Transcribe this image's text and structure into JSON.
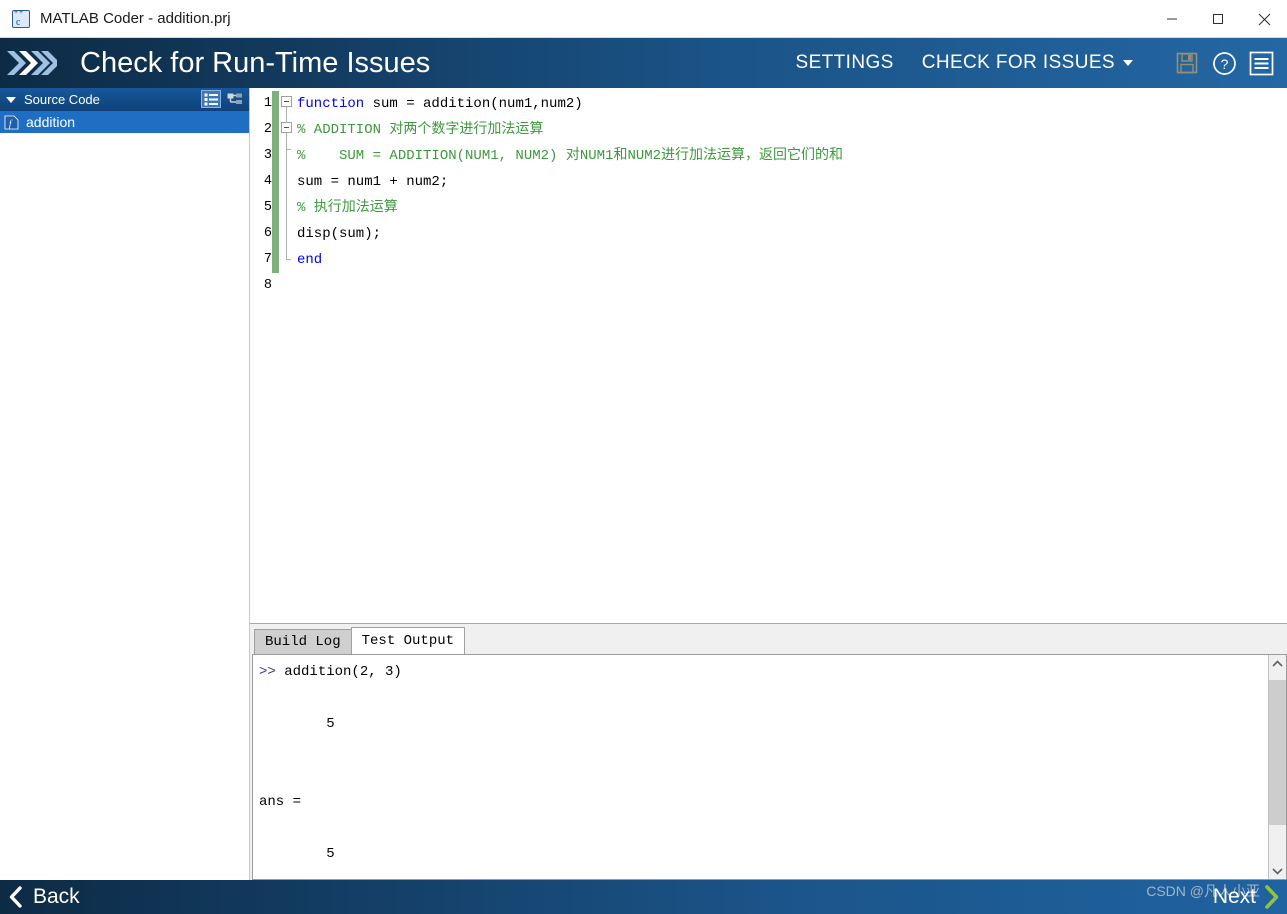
{
  "window": {
    "title": "MATLAB Coder - addition.prj",
    "icon": "matlab-coder-icon",
    "controls": [
      {
        "name": "minimize",
        "glyph": "minimize-icon"
      },
      {
        "name": "maximize",
        "glyph": "maximize-icon"
      },
      {
        "name": "close",
        "glyph": "close-icon"
      }
    ]
  },
  "toolbar": {
    "logo": "chevrons-icon",
    "title": "Check for Run-Time Issues",
    "settings_label": "SETTINGS",
    "check_label": "CHECK FOR ISSUES",
    "check_has_caret": true,
    "icons": [
      {
        "name": "save-icon",
        "enabled": false
      },
      {
        "name": "help-icon",
        "enabled": true
      },
      {
        "name": "menu-icon",
        "enabled": true
      }
    ],
    "colors": {
      "gradient_start": "#0d2b45",
      "gradient_end": "#2467a3",
      "text": "#ffffff"
    }
  },
  "sidebar": {
    "header": {
      "label": "Source Code",
      "collapsed": false
    },
    "header_icons": [
      {
        "name": "list-view-icon",
        "selected": true
      },
      {
        "name": "tree-view-icon",
        "selected": false
      }
    ],
    "items": [
      {
        "label": "addition",
        "icon": "matlab-function-file-icon",
        "selected": true
      }
    ]
  },
  "editor": {
    "line_numbers": [
      "1",
      "2",
      "3",
      "4",
      "5",
      "6",
      "7",
      "8"
    ],
    "modified_marker_color": "#7db07b",
    "lines": [
      [
        {
          "t": "function",
          "c": "kw"
        },
        {
          "t": " sum = addition(num1,num2)",
          "c": "df"
        }
      ],
      [
        {
          "t": "% ADDITION 对两个数字进行加法运算",
          "c": "cm"
        }
      ],
      [
        {
          "t": "%    SUM = ADDITION(NUM1, NUM2) 对NUM1和NUM2进行加法运算，返回它们的和",
          "c": "cm"
        }
      ],
      [
        {
          "t": "sum = num1 + num2;",
          "c": "df"
        }
      ],
      [
        {
          "t": "% 执行加法运算",
          "c": "cm"
        }
      ],
      [
        {
          "t": "disp(sum);",
          "c": "df"
        }
      ],
      [
        {
          "t": "end",
          "c": "kw"
        }
      ],
      []
    ]
  },
  "bottom_panel": {
    "tabs": [
      {
        "label": "Build Log",
        "active": false
      },
      {
        "label": "Test Output",
        "active": true
      }
    ],
    "output_lines": [
      ">> addition(2, 3)",
      "",
      "        5",
      "",
      "",
      "ans =",
      "",
      "        5"
    ],
    "output_prompt": ">>",
    "scrollbar": {
      "up": "chevron-up-icon",
      "down": "chevron-down-icon"
    }
  },
  "footer": {
    "back_label": "Back",
    "back_icon": "chevron-left-icon",
    "next_label": "Next",
    "next_icon": "chevron-right-icon",
    "watermark": "CSDN @凡人小亚"
  }
}
